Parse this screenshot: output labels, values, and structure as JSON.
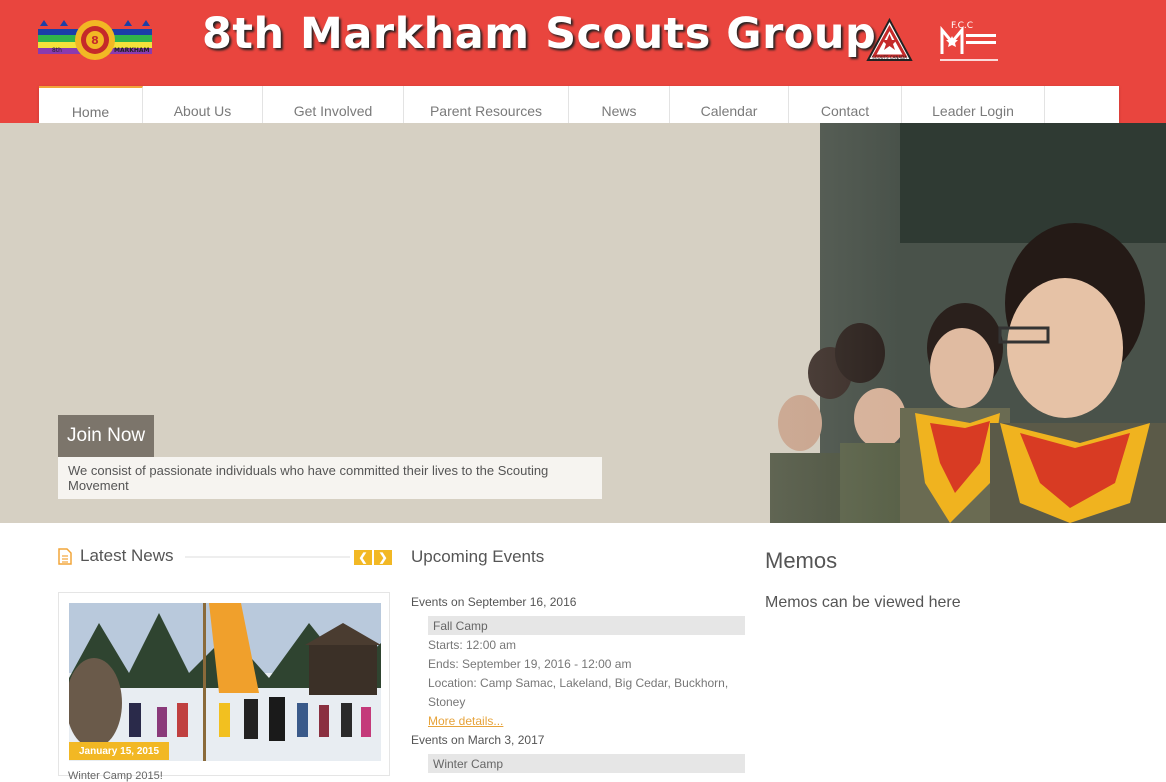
{
  "header": {
    "title": "8th Markham Scouts Group",
    "group_logo_text_left": "8th",
    "group_logo_text_right": "MARKHAM",
    "scouts_canada_logo_text": "SCOUTS CANADA",
    "fcc_logo_text": "F.C.C",
    "colors": {
      "header_bg": "#e9453e",
      "accent": "#f2b824"
    }
  },
  "nav": {
    "items": [
      {
        "label": "Home",
        "active": true
      },
      {
        "label": "About Us"
      },
      {
        "label": "Get Involved"
      },
      {
        "label": "Parent Resources"
      },
      {
        "label": "News"
      },
      {
        "label": "Calendar"
      },
      {
        "label": "Contact"
      },
      {
        "label": "Leader Login"
      }
    ]
  },
  "hero": {
    "heading": "Join Now",
    "description": "We consist of passionate individuals who have committed their lives to the Scouting Movement"
  },
  "latest_news": {
    "title": "Latest News",
    "icon": "document-icon",
    "prev_icon": "chevron-left-icon",
    "next_icon": "chevron-right-icon",
    "card_date": "January 15, 2015",
    "card_caption": "Winter Camp 2015!"
  },
  "upcoming_events": {
    "title": "Upcoming Events",
    "groups": [
      {
        "date": "Events on September 16, 2016",
        "name": "Fall Camp",
        "starts": "Starts: 12:00 am",
        "ends": "Ends: September 19, 2016 - 12:00 am",
        "location_line1": "Location: Camp Samac, Lakeland, Big Cedar, Buckhorn,",
        "location_line2": "Stoney",
        "more": "More details..."
      },
      {
        "date": "Events on March 3, 2017",
        "name": "Winter Camp"
      }
    ]
  },
  "memos": {
    "title": "Memos",
    "text": "Memos can be viewed here"
  }
}
